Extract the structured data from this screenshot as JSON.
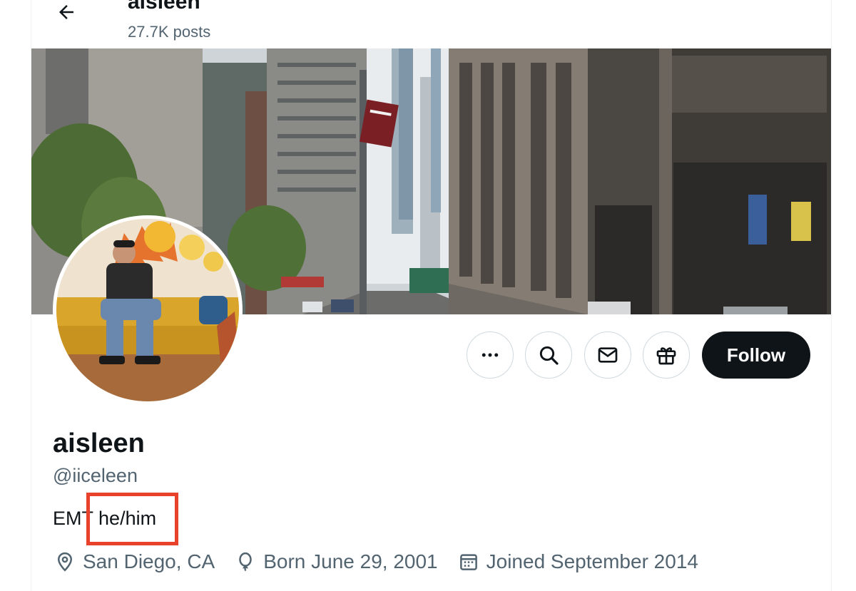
{
  "header": {
    "name": "aisleen",
    "posts_count": "27.7K posts"
  },
  "actions": {
    "follow_label": "Follow"
  },
  "profile": {
    "display_name": "aisleen",
    "handle": "@iiceleen",
    "bio_prefix": "EMT",
    "bio_highlighted": "he/him"
  },
  "meta": {
    "location": "San Diego, CA",
    "birthday": "Born June 29, 2001",
    "joined": "Joined September 2014"
  },
  "colors": {
    "primary_text": "#0f1419",
    "secondary_text": "#536471",
    "button_border": "#cfd9de",
    "highlight_box": "#e8412c"
  },
  "icons": [
    "back-arrow-icon",
    "more-icon",
    "search-icon",
    "message-icon",
    "gift-icon",
    "location-icon",
    "balloon-icon",
    "calendar-icon"
  ]
}
